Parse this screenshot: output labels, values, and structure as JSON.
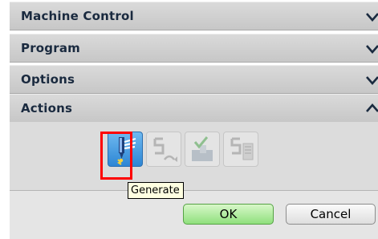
{
  "sections": [
    {
      "label": "Machine Control",
      "state": "collapsed"
    },
    {
      "label": "Program",
      "state": "collapsed"
    },
    {
      "label": "Options",
      "state": "collapsed"
    },
    {
      "label": "Actions",
      "state": "expanded"
    }
  ],
  "actions": {
    "tools": [
      {
        "icon": "generate-icon",
        "enabled": true,
        "selected": true
      },
      {
        "icon": "replay-icon",
        "enabled": false
      },
      {
        "icon": "verify-icon",
        "enabled": false
      },
      {
        "icon": "list-icon",
        "enabled": false
      }
    ]
  },
  "tooltip": {
    "text": "Generate"
  },
  "buttons": {
    "ok": "OK",
    "cancel": "Cancel"
  }
}
